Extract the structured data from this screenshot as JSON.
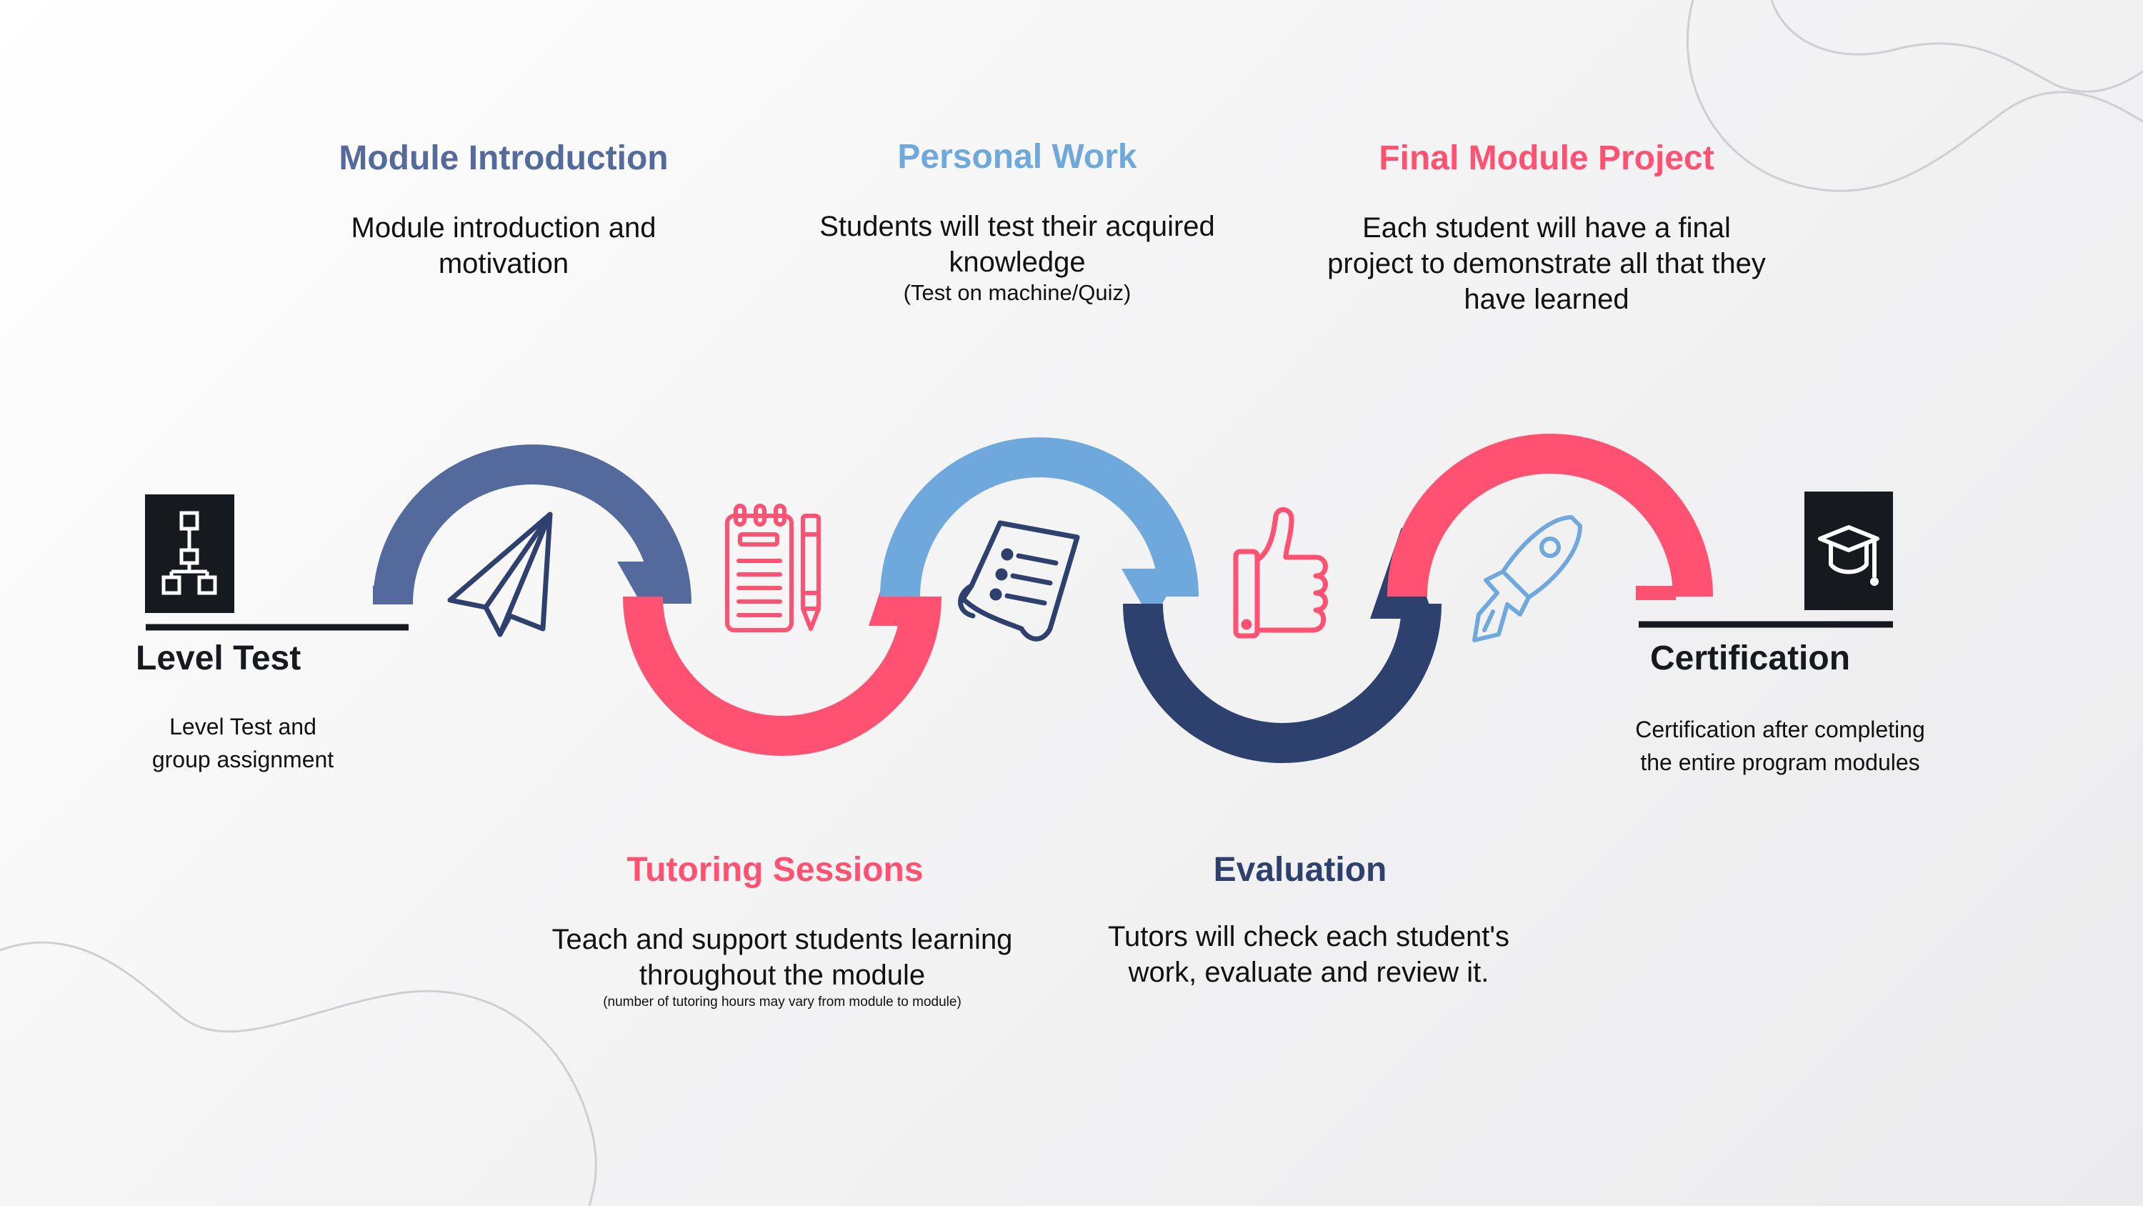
{
  "colors": {
    "slate_blue": "#546A9D",
    "light_blue": "#6FA8DC",
    "pink": "#FF5272",
    "navy": "#2E406E",
    "dark": "#16191D"
  },
  "steps": {
    "level_test": {
      "title": "Level Test",
      "desc_lines": [
        "Level Test and",
        "group assignment"
      ],
      "icon": "hierarchy-icon"
    },
    "module_intro": {
      "title": "Module Introduction",
      "desc_lines": [
        "Module introduction and",
        "motivation"
      ],
      "icon": "paper-plane-icon"
    },
    "tutoring": {
      "title": "Tutoring Sessions",
      "desc_lines": [
        "Teach and support students learning",
        "throughout the module"
      ],
      "note": "(number of tutoring hours may vary from module to module)",
      "icon": "notepad-pen-icon"
    },
    "personal_work": {
      "title": "Personal Work",
      "desc_lines": [
        "Students will test their acquired",
        "knowledge"
      ],
      "note": "(Test on machine/Quiz)",
      "icon": "scroll-checklist-icon"
    },
    "evaluation": {
      "title": "Evaluation",
      "desc_lines": [
        "Tutors will check each student's",
        "work, evaluate and review it."
      ],
      "icon": "thumbs-up-icon"
    },
    "final_project": {
      "title": "Final Module Project",
      "desc_lines": [
        "Each student will have a final",
        "project to demonstrate all that they",
        "have learned"
      ],
      "icon": "rocket-icon"
    },
    "certification": {
      "title": "Certification",
      "desc_lines": [
        "Certification after completing",
        "the entire program modules"
      ],
      "icon": "graduation-cap-icon"
    }
  }
}
